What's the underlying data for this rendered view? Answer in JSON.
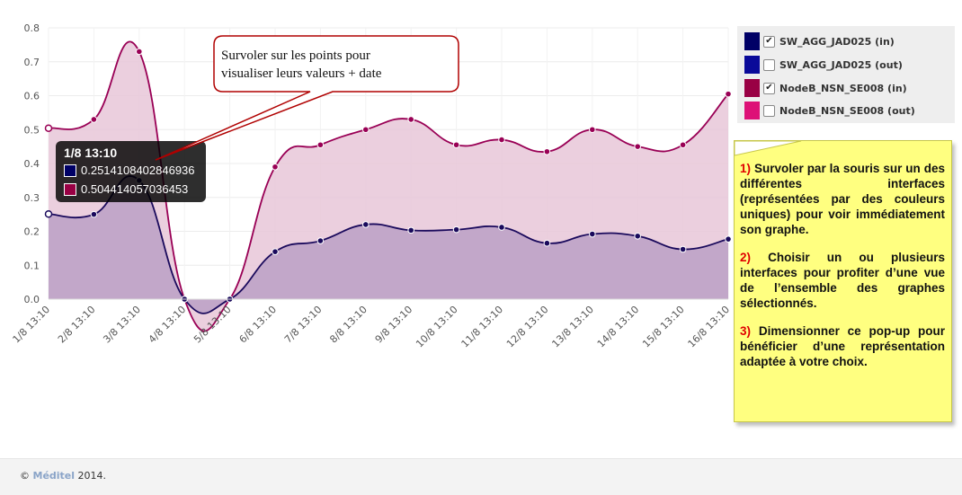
{
  "chart_data": {
    "type": "area",
    "categories": [
      "1/8 13:10",
      "2/8 13:10",
      "3/8 13:10",
      "4/8 13:10",
      "5/8 13:10",
      "6/8 13:10",
      "7/8 13:10",
      "8/8 13:10",
      "9/8 13:10",
      "10/8 13:10",
      "11/8 13:10",
      "12/8 13:10",
      "13/8 13:10",
      "14/8 13:10",
      "15/8 13:10",
      "16/8 13:10"
    ],
    "series": [
      {
        "name": "NodeB_NSN_SE008 (in)",
        "color": "#990055",
        "fill": "#e8c7d8",
        "values": [
          0.504,
          0.53,
          0.73,
          0.0,
          0.0,
          0.39,
          0.455,
          0.5,
          0.53,
          0.455,
          0.47,
          0.435,
          0.5,
          0.45,
          0.455,
          0.605
        ]
      },
      {
        "name": "SW_AGG_JAD025 (in)",
        "color": "#1a0a5c",
        "fill": "#bba0c5",
        "values": [
          0.251,
          0.25,
          0.35,
          0.0,
          0.0,
          0.14,
          0.172,
          0.22,
          0.203,
          0.205,
          0.212,
          0.165,
          0.192,
          0.186,
          0.147,
          0.177
        ]
      }
    ],
    "ylim": [
      0,
      0.8
    ],
    "yticks": [
      "0.0",
      "0.1",
      "0.2",
      "0.3",
      "0.4",
      "0.5",
      "0.6",
      "0.7",
      "0.8"
    ],
    "grid": true
  },
  "legend": {
    "items": [
      {
        "label": "SW_AGG_JAD025 (in)",
        "color": "#000066",
        "checked": true,
        "mark": "✔"
      },
      {
        "label": "SW_AGG_JAD025 (out)",
        "color": "#0a0a99",
        "checked": false,
        "mark": ""
      },
      {
        "label": "NodeB_NSN_SE008 (in)",
        "color": "#990044",
        "checked": true,
        "mark": "✔"
      },
      {
        "label": "NodeB_NSN_SE008 (out)",
        "color": "#dd1177",
        "checked": false,
        "mark": ""
      }
    ]
  },
  "tooltip": {
    "title": "1/8 13:10",
    "rows": [
      {
        "color": "#000066",
        "value": "0.2514108402846936"
      },
      {
        "color": "#990044",
        "value": "0.504414057036453"
      }
    ]
  },
  "callout": {
    "line1": "Survoler sur les points pour",
    "line2": "visualiser leurs valeurs + date"
  },
  "note": {
    "p1_num": "1)",
    "p1_text": " Survoler par la souris sur un des différentes interfaces (représentées par des couleurs uniques) pour voir immédiatement son graphe.",
    "p2_num": "2)",
    "p2_text": " Choisir un ou plusieurs interfaces pour profiter d’une vue de l’ensemble des graphes sélectionnés.",
    "p3_num": "3)",
    "p3_text": " Dimensionner ce pop-up pour bénéficier d’une représentation adaptée à votre choix."
  },
  "footer": {
    "copyright": "©",
    "brand": "Méditel",
    "year": "2014."
  }
}
